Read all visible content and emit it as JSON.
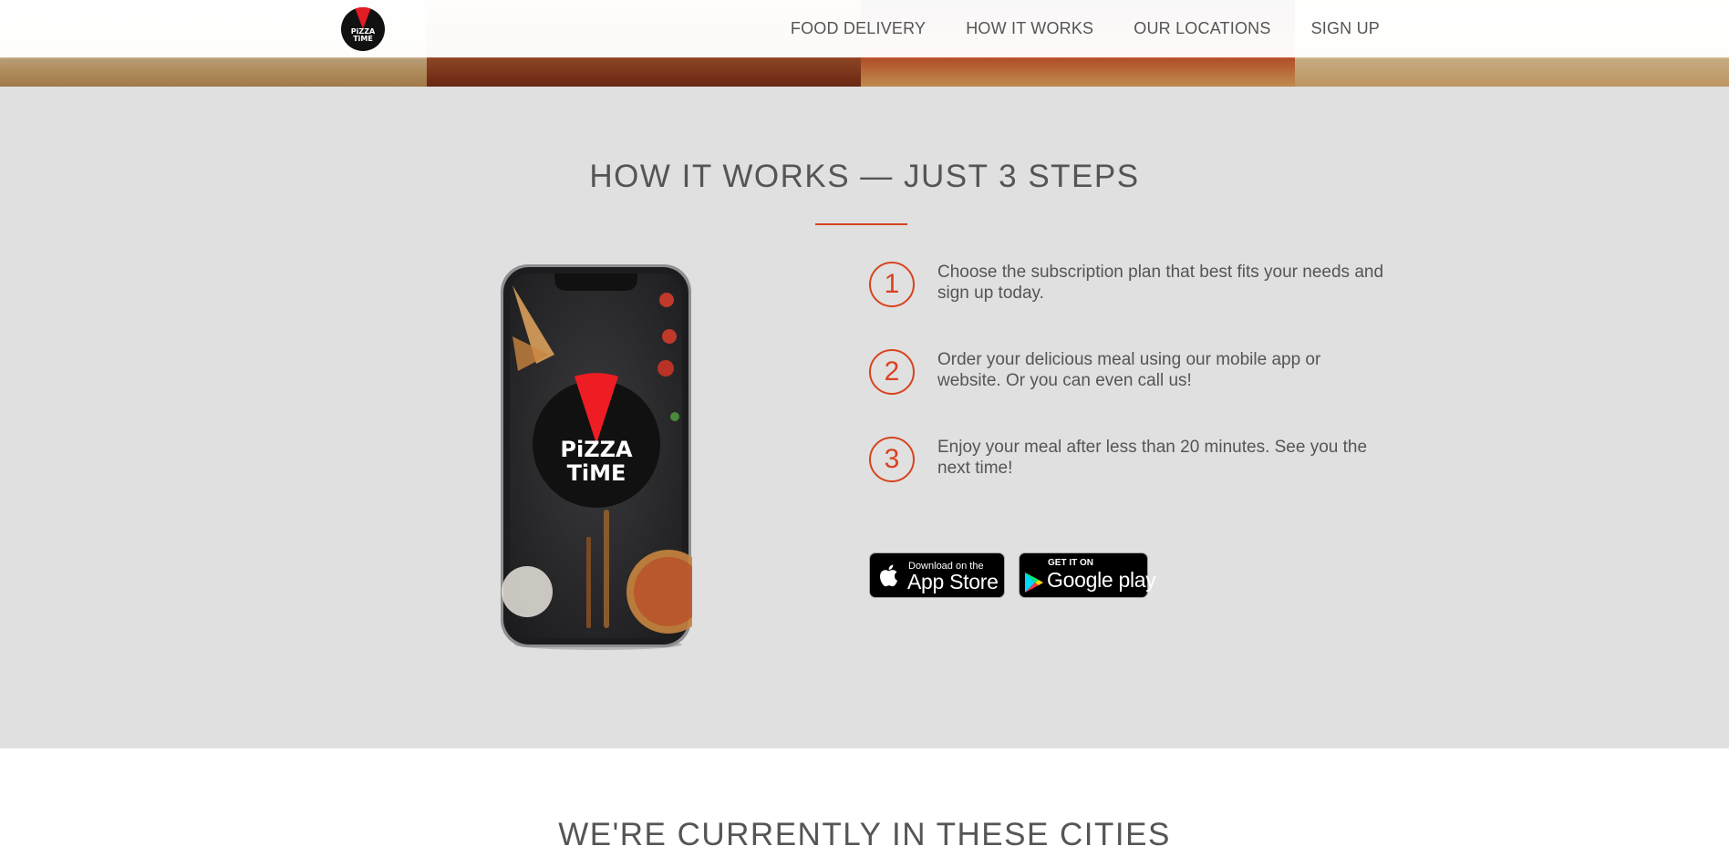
{
  "brand": {
    "logo_line1": "PiZZA",
    "logo_line2": "TiME"
  },
  "nav": {
    "links": [
      {
        "label": "FOOD DELIVERY"
      },
      {
        "label": "HOW IT WORKS"
      },
      {
        "label": "OUR LOCATIONS"
      },
      {
        "label": "SIGN UP"
      }
    ]
  },
  "how_it_works": {
    "title": "HOW IT WORKS — JUST 3 STEPS",
    "steps": [
      {
        "number": "1",
        "text": "Choose the subscription plan that best fits your needs and sign up today."
      },
      {
        "number": "2",
        "text": "Order your delicious meal using our mobile app or website. Or you can even call us!"
      },
      {
        "number": "3",
        "text": "Enjoy your meal after less than 20 minutes. See you the next time!"
      }
    ],
    "phone_screen": {
      "logo_line1": "PiZZA",
      "logo_line2": "TiME"
    },
    "badges": {
      "app_store": {
        "small": "Download on the",
        "big": "App Store"
      },
      "google_play": {
        "small": "GET IT ON",
        "big": "Google play"
      }
    }
  },
  "cities": {
    "title": "WE'RE CURRENTLY IN THESE CITIES"
  },
  "colors": {
    "accent": "#d8431f",
    "logo_red": "#e31b23",
    "section_bg": "#e0e0e0",
    "text": "#555555"
  }
}
